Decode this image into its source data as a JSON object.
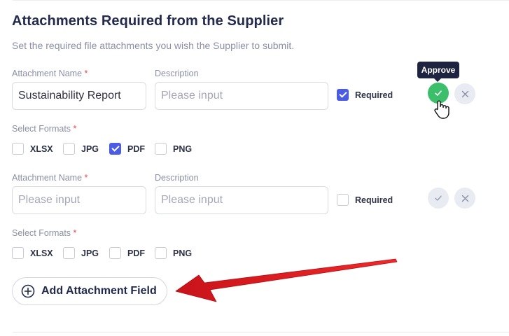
{
  "section": {
    "title": "Attachments Required from the Supplier",
    "subtitle": "Set the required file attachments you wish the Supplier to submit."
  },
  "attachments": [
    {
      "name_label": "Attachment Name",
      "name_required_mark": "*",
      "name_value": "Sustainability Report",
      "name_placeholder": "Please input",
      "description_label": "Description",
      "description_placeholder": "Please input",
      "required_label": "Required",
      "required_checked": true,
      "formats_label": "Select Formats",
      "formats_required_mark": "*",
      "formats": [
        {
          "label": "XLSX",
          "checked": false
        },
        {
          "label": "JPG",
          "checked": false
        },
        {
          "label": "PDF",
          "checked": true
        },
        {
          "label": "PNG",
          "checked": false
        }
      ],
      "approve_state": "active",
      "tooltip": "Approve"
    },
    {
      "name_label": "Attachment Name",
      "name_required_mark": "*",
      "name_value": "",
      "name_placeholder": "Please input",
      "description_label": "Description",
      "description_placeholder": "Please input",
      "required_label": "Required",
      "required_checked": false,
      "formats_label": "Select Formats",
      "formats_required_mark": "*",
      "formats": [
        {
          "label": "XLSX",
          "checked": false
        },
        {
          "label": "JPG",
          "checked": false
        },
        {
          "label": "PDF",
          "checked": false
        },
        {
          "label": "PNG",
          "checked": false
        }
      ],
      "approve_state": "muted"
    }
  ],
  "add_button": {
    "label": "Add Attachment Field",
    "icon": "plus-circle-icon"
  },
  "colors": {
    "accent": "#4a5ce6",
    "approve": "#3cbf6a",
    "required_star": "#e5484d",
    "tooltip_bg": "#1e2440",
    "annotation_arrow": "#e01b1b"
  }
}
